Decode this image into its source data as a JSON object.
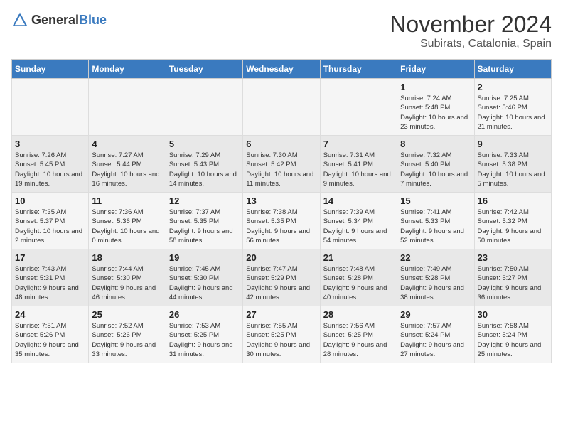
{
  "header": {
    "logo_general": "General",
    "logo_blue": "Blue",
    "month_title": "November 2024",
    "subtitle": "Subirats, Catalonia, Spain"
  },
  "days_of_week": [
    "Sunday",
    "Monday",
    "Tuesday",
    "Wednesday",
    "Thursday",
    "Friday",
    "Saturday"
  ],
  "weeks": [
    [
      {
        "day": "",
        "info": ""
      },
      {
        "day": "",
        "info": ""
      },
      {
        "day": "",
        "info": ""
      },
      {
        "day": "",
        "info": ""
      },
      {
        "day": "",
        "info": ""
      },
      {
        "day": "1",
        "info": "Sunrise: 7:24 AM\nSunset: 5:48 PM\nDaylight: 10 hours and 23 minutes."
      },
      {
        "day": "2",
        "info": "Sunrise: 7:25 AM\nSunset: 5:46 PM\nDaylight: 10 hours and 21 minutes."
      }
    ],
    [
      {
        "day": "3",
        "info": "Sunrise: 7:26 AM\nSunset: 5:45 PM\nDaylight: 10 hours and 19 minutes."
      },
      {
        "day": "4",
        "info": "Sunrise: 7:27 AM\nSunset: 5:44 PM\nDaylight: 10 hours and 16 minutes."
      },
      {
        "day": "5",
        "info": "Sunrise: 7:29 AM\nSunset: 5:43 PM\nDaylight: 10 hours and 14 minutes."
      },
      {
        "day": "6",
        "info": "Sunrise: 7:30 AM\nSunset: 5:42 PM\nDaylight: 10 hours and 11 minutes."
      },
      {
        "day": "7",
        "info": "Sunrise: 7:31 AM\nSunset: 5:41 PM\nDaylight: 10 hours and 9 minutes."
      },
      {
        "day": "8",
        "info": "Sunrise: 7:32 AM\nSunset: 5:40 PM\nDaylight: 10 hours and 7 minutes."
      },
      {
        "day": "9",
        "info": "Sunrise: 7:33 AM\nSunset: 5:38 PM\nDaylight: 10 hours and 5 minutes."
      }
    ],
    [
      {
        "day": "10",
        "info": "Sunrise: 7:35 AM\nSunset: 5:37 PM\nDaylight: 10 hours and 2 minutes."
      },
      {
        "day": "11",
        "info": "Sunrise: 7:36 AM\nSunset: 5:36 PM\nDaylight: 10 hours and 0 minutes."
      },
      {
        "day": "12",
        "info": "Sunrise: 7:37 AM\nSunset: 5:35 PM\nDaylight: 9 hours and 58 minutes."
      },
      {
        "day": "13",
        "info": "Sunrise: 7:38 AM\nSunset: 5:35 PM\nDaylight: 9 hours and 56 minutes."
      },
      {
        "day": "14",
        "info": "Sunrise: 7:39 AM\nSunset: 5:34 PM\nDaylight: 9 hours and 54 minutes."
      },
      {
        "day": "15",
        "info": "Sunrise: 7:41 AM\nSunset: 5:33 PM\nDaylight: 9 hours and 52 minutes."
      },
      {
        "day": "16",
        "info": "Sunrise: 7:42 AM\nSunset: 5:32 PM\nDaylight: 9 hours and 50 minutes."
      }
    ],
    [
      {
        "day": "17",
        "info": "Sunrise: 7:43 AM\nSunset: 5:31 PM\nDaylight: 9 hours and 48 minutes."
      },
      {
        "day": "18",
        "info": "Sunrise: 7:44 AM\nSunset: 5:30 PM\nDaylight: 9 hours and 46 minutes."
      },
      {
        "day": "19",
        "info": "Sunrise: 7:45 AM\nSunset: 5:30 PM\nDaylight: 9 hours and 44 minutes."
      },
      {
        "day": "20",
        "info": "Sunrise: 7:47 AM\nSunset: 5:29 PM\nDaylight: 9 hours and 42 minutes."
      },
      {
        "day": "21",
        "info": "Sunrise: 7:48 AM\nSunset: 5:28 PM\nDaylight: 9 hours and 40 minutes."
      },
      {
        "day": "22",
        "info": "Sunrise: 7:49 AM\nSunset: 5:28 PM\nDaylight: 9 hours and 38 minutes."
      },
      {
        "day": "23",
        "info": "Sunrise: 7:50 AM\nSunset: 5:27 PM\nDaylight: 9 hours and 36 minutes."
      }
    ],
    [
      {
        "day": "24",
        "info": "Sunrise: 7:51 AM\nSunset: 5:26 PM\nDaylight: 9 hours and 35 minutes."
      },
      {
        "day": "25",
        "info": "Sunrise: 7:52 AM\nSunset: 5:26 PM\nDaylight: 9 hours and 33 minutes."
      },
      {
        "day": "26",
        "info": "Sunrise: 7:53 AM\nSunset: 5:25 PM\nDaylight: 9 hours and 31 minutes."
      },
      {
        "day": "27",
        "info": "Sunrise: 7:55 AM\nSunset: 5:25 PM\nDaylight: 9 hours and 30 minutes."
      },
      {
        "day": "28",
        "info": "Sunrise: 7:56 AM\nSunset: 5:25 PM\nDaylight: 9 hours and 28 minutes."
      },
      {
        "day": "29",
        "info": "Sunrise: 7:57 AM\nSunset: 5:24 PM\nDaylight: 9 hours and 27 minutes."
      },
      {
        "day": "30",
        "info": "Sunrise: 7:58 AM\nSunset: 5:24 PM\nDaylight: 9 hours and 25 minutes."
      }
    ]
  ]
}
